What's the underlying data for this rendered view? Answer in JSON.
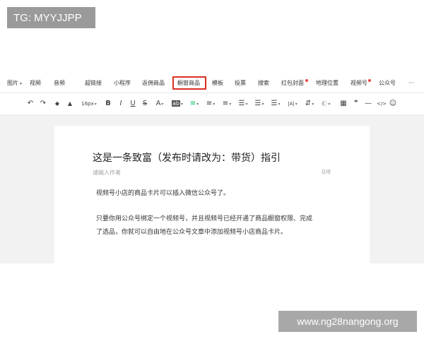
{
  "watermark_tag": "TG: MYYJJPP",
  "watermark_url": "www.ng28nangong.org",
  "menu": {
    "image": "图片",
    "video": "视频",
    "audio": "音频",
    "hyperlink": "超链接",
    "miniprogram": "小程序",
    "commission_goods": "返佣商品",
    "window_goods": "橱窗商品",
    "template": "模板",
    "vote": "投票",
    "search": "搜索",
    "red_packet_cover": "红包封面",
    "location": "地理位置",
    "channels": "视频号",
    "official_account": "公众号",
    "more": "···"
  },
  "toolbar": {
    "undo": "↶",
    "redo": "↷",
    "format_painter": "◆",
    "clear_format": "▲",
    "font_size": "16px",
    "bold": "B",
    "italic": "I",
    "underline": "U",
    "strikethrough": "S",
    "font_color": "A",
    "background_color": "ab",
    "align": "≡",
    "indent": "≡",
    "line_height": "≡",
    "list_unordered": "☰",
    "list_ordered": "☰",
    "letter_spacing": "|A|",
    "text_direction": "⇵",
    "table": "▦",
    "quote": "❞",
    "divider": "—",
    "code": "</>",
    "emoji": "☺"
  },
  "document": {
    "title": "这是一条致富（发布时请改为：带货）指引",
    "author_placeholder": "请输入作者",
    "author_counter": "0/8",
    "paragraph1": "视频号小店的商品卡片可以插入微信公众号了。",
    "paragraph2_line1": "只要你用公众号绑定一个视频号，并且视频号已经开通了商品橱窗权限、完成",
    "paragraph2_line2": "了选品，你就可以自由地在公众号文章中添加视频号小店商品卡片。"
  },
  "colors": {
    "highlight": "#d93025",
    "accent_green": "#07c160",
    "red_dot": "#f04545"
  }
}
